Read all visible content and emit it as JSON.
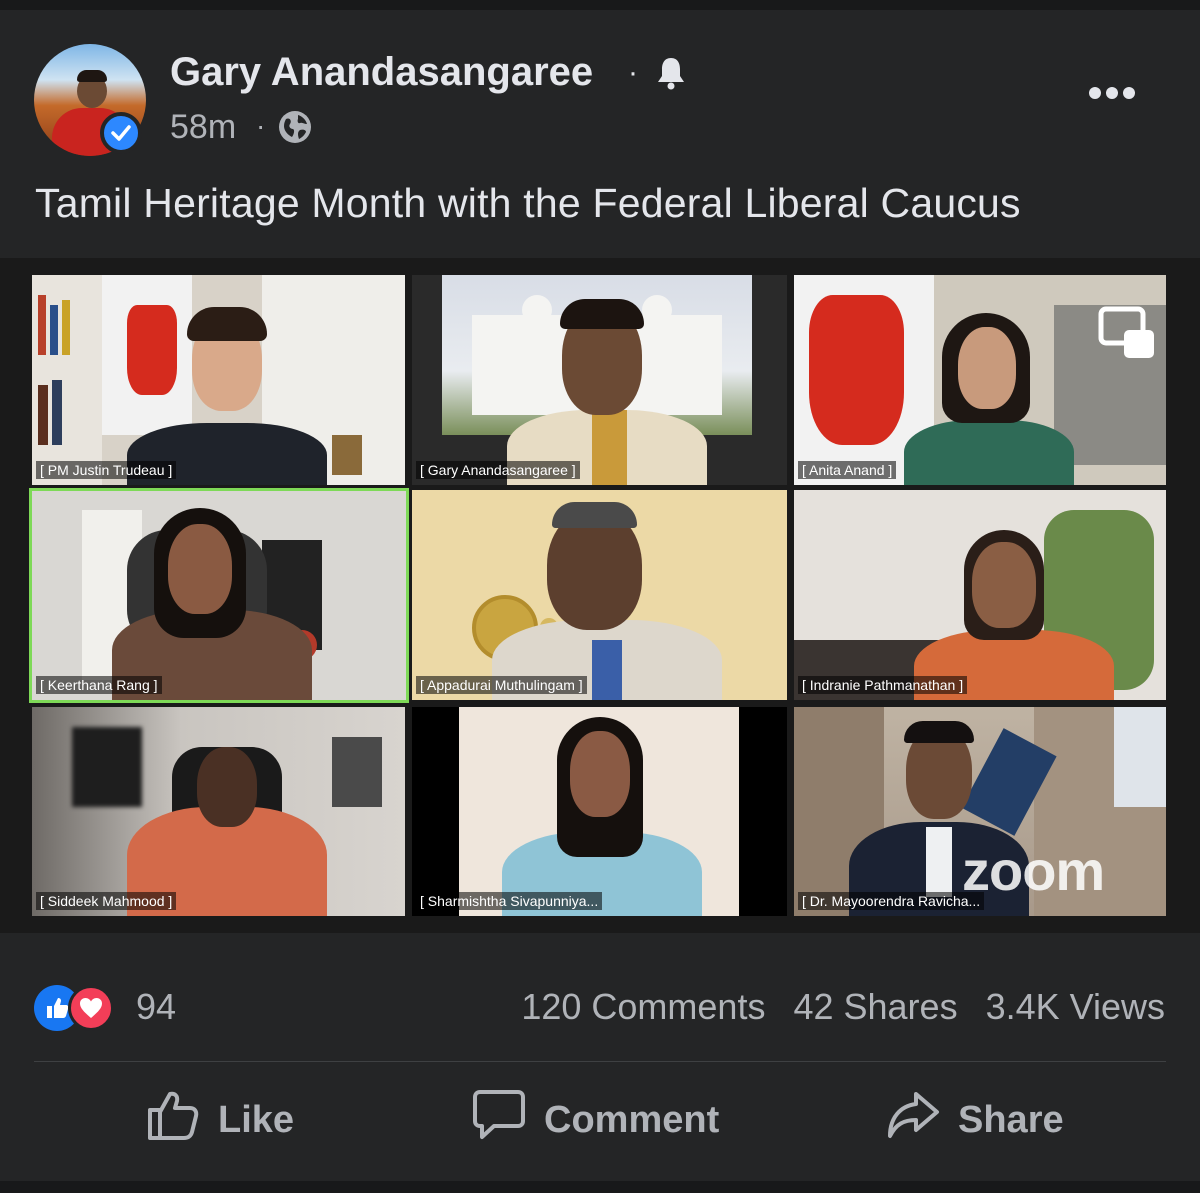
{
  "post": {
    "author": "Gary Anandasangaree",
    "separator": "·",
    "time": "58m",
    "text": "Tamil Heritage Month with the Federal Liberal Caucus"
  },
  "video_call": {
    "participants": [
      "[ PM Justin Trudeau ]",
      "[ Gary Anandasangaree ]",
      "[ Anita Anand ]",
      "[ Keerthana Rang ]",
      "[ Appadurai Muthulingam ]",
      "[ Indranie Pathmanathan ]",
      "[ Siddeek Mahmood ]",
      "[ Sharmishtha Sivapunniya...",
      "[ Dr. Mayoorendra Ravicha..."
    ],
    "watermark": "zoom",
    "active_speaker": "Keerthana Rang"
  },
  "engagement": {
    "reaction_count": "94",
    "comments": "120 Comments",
    "shares": "42 Shares",
    "views": "3.4K Views"
  },
  "actions": {
    "like": "Like",
    "comment": "Comment",
    "share": "Share"
  },
  "colors": {
    "background": "#242526",
    "verified": "#2d88ff",
    "like": "#1877f2",
    "love": "#f33e58",
    "active_speaker_border": "#7ed957"
  }
}
